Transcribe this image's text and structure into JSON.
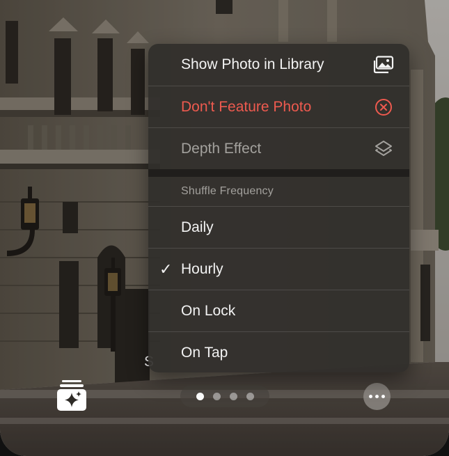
{
  "menu": {
    "items": [
      {
        "label": "Show Photo in Library",
        "icon": "photo-library-icon"
      },
      {
        "label": "Don't Feature Photo",
        "icon": "x-circle-icon",
        "color": "#ee5a4f"
      },
      {
        "label": "Depth Effect",
        "icon": "layers-icon",
        "disabled": true
      }
    ],
    "section_title": "Shuffle Frequency",
    "options": [
      {
        "label": "Daily",
        "selected": false
      },
      {
        "label": "Hourly",
        "selected": true
      },
      {
        "label": "On Lock",
        "selected": false
      },
      {
        "label": "On Tap",
        "selected": false
      }
    ],
    "checkmark": "✓"
  },
  "overlay_text": "S",
  "page_indicator": {
    "count": 4,
    "active_index": 0
  },
  "bottom": {
    "library_icon": "photo-stack-sparkle-icon",
    "more_icon": "ellipsis-icon"
  }
}
